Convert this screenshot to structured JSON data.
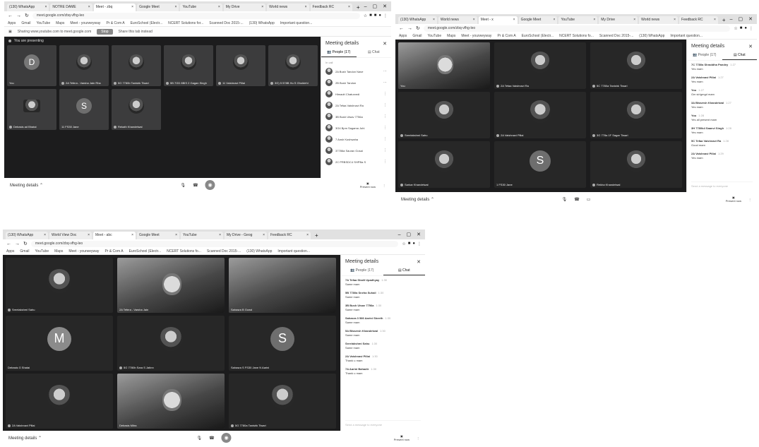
{
  "shot1": {
    "tabs": [
      "(130) WhatsApp",
      "NOTRE DAME",
      "Meet - zbq",
      "Google Meet",
      "YouTube",
      "My Drive",
      "World news",
      "Feedback RC"
    ],
    "url": "meet.google.com/zbq-vfhg-leo",
    "bookmarks": [
      "Apps",
      "Gmail",
      "YouTube",
      "Maps",
      "Meet - yourweyway",
      "Pr & Com A",
      "EuroSchool (Electr...",
      "NCERT Solutions for...",
      "Scanned Doc 2015-...",
      "(130) WhatsApp",
      "Important question..."
    ],
    "infobar_text": "Sharing www.youtube.com to meet.google.com",
    "infobar_button": "Stop",
    "infobar_hide": "Share this tab instead",
    "presenting_label": "You are presenting",
    "tiles": [
      {
        "name": "You",
        "avatar": "D"
      },
      {
        "name": "2A Tefera - Varsha Jain Rha",
        "avatar": ""
      },
      {
        "name": "5G 7780b Tanishk Tiwari",
        "avatar": ""
      },
      {
        "name": "5B 7GD 8BIS 2 Gagan Singh",
        "avatar": ""
      },
      {
        "name": "11 Vaishnavi Pillai",
        "avatar": ""
      },
      {
        "name": "3G) 5 578B Hu S Gholdehi",
        "avatar": ""
      },
      {
        "name": "Debasis ad Bhatai",
        "avatar": ""
      },
      {
        "name": "11 FS30 Jane",
        "avatar": "S"
      },
      {
        "name": "Rekath Khandelwal",
        "avatar": ""
      }
    ],
    "panel": {
      "title": "Meeting details",
      "tab_people": "People (17)",
      "tab_chat": "Chat",
      "section": "In call",
      "people": [
        "2A Bush Tandon Nave",
        "2B Bush Tandon",
        "Himadri Chaturvedi",
        "2A Tefaa Vaishnavi Ra",
        "3B Bush Utsav 7756a",
        "3G4 Bpm Sagama Juhi",
        "7 Ansh Kushwaha",
        "37786a Saurav Gosai",
        "2C PRBSDC4 SHPBa S"
      ]
    },
    "bottom": {
      "details": "Meeting details",
      "present": "Present now"
    }
  },
  "shot2": {
    "tabs": [
      "(130) WhatsApp",
      "World news",
      "Meet - x",
      "Google Meet",
      "YouTube",
      "My Drive",
      "World news",
      "Feedback RC"
    ],
    "url": "meet.google.com/zbq-vfhg-leo",
    "bookmarks": [
      "Apps",
      "Gmail",
      "YouTube",
      "Maps",
      "Meet - yourweyway",
      "Pr & Com A",
      "EuroSchool (Electr...",
      "NCERT Solutions fo...",
      "Scanned Doc 2015-...",
      "(130) WhatsApp",
      "Important question..."
    ],
    "tiles": [
      {
        "name": "You",
        "avatar": ""
      },
      {
        "name": "2A Tefaa Vaishnavi Ra",
        "avatar": ""
      },
      {
        "name": "5C 7780a Tanishk Tiwari",
        "avatar": ""
      },
      {
        "name": "Sreelakshmi Sahu",
        "avatar": ""
      },
      {
        "name": "2A Vaishnavi Pillai",
        "avatar": ""
      },
      {
        "name": "3G 778a 1F Sagar Tiwari",
        "avatar": ""
      },
      {
        "name": "Sarkar Khandelwal",
        "avatar": ""
      },
      {
        "name": "1 FS30 Jane",
        "avatar": "S"
      },
      {
        "name": "Rekha Khandelwal",
        "avatar": ""
      }
    ],
    "panel": {
      "title": "Meeting details",
      "tab_people": "People (17)",
      "tab_chat": "Chat",
      "messages": [
        {
          "who": "7C 7780a Shraddha Pandey",
          "time": "1:27",
          "text": "Yes mam"
        },
        {
          "who": "2A Vaishnavi Pillai",
          "time": "1:27",
          "text": "Yes mam"
        },
        {
          "who": "You",
          "time": "1:27",
          "text": "Gm sir/gmgd mam"
        },
        {
          "who": "3A Bhavesh Khandelwal",
          "time": "1:27",
          "text": "Yes mam"
        },
        {
          "who": "You",
          "time": "1:28",
          "text": "Yes all present mam"
        },
        {
          "who": "3H 7780b4 Saanvi Singh",
          "time": "1:28",
          "text": "Yes mam"
        },
        {
          "who": "5C Tefaa Vaishnavi Ra",
          "time": "1:28",
          "text": "Good mam"
        },
        {
          "who": "2A Vaishnavi Pillai",
          "time": "1:29",
          "text": "Yes mam"
        }
      ],
      "input": "Send a message to everyone"
    },
    "bottom": {
      "details": "Meeting details",
      "present": "Present now"
    }
  },
  "shot3": {
    "tabs": [
      "(130) WhatsApp",
      "World View Doc",
      "Meet - abc",
      "Google Meet",
      "YouTube",
      "My Drive - Geog",
      "Feedback RC"
    ],
    "url": "meet.google.com/zbq-vfhg-leo",
    "bookmarks": [
      "Apps",
      "Gmail",
      "YouTube",
      "Maps",
      "Meet - yourweyway",
      "Pr & Com A",
      "EuroSchool (Electr...",
      "NCERT Solutions fo...",
      "Scanned Doc 2015-...",
      "(130) WhatsApp",
      "Important question..."
    ],
    "tiles": [
      {
        "name": "Sreelakshmi Sahu",
        "avatar": "",
        "kind": "photo"
      },
      {
        "name": "2A Tefera - Varsha Jain",
        "avatar": "",
        "kind": "video"
      },
      {
        "name": "Sahasra B Gowd",
        "avatar": "",
        "kind": "video"
      },
      {
        "name": "Debasis G Shatai",
        "avatar": "M",
        "kind": "avatar",
        "color": "#8a8a8a"
      },
      {
        "name": "5G 7780b Sara S Jatinn",
        "avatar": "",
        "kind": "photo"
      },
      {
        "name": "Sahasra S FS30 Jane N Aarini",
        "avatar": "S",
        "kind": "avatar",
        "color": "#6f6f6f"
      },
      {
        "name": "2A Vaishnavi Pillai",
        "avatar": "",
        "kind": "photo"
      },
      {
        "name": "Debasis Mitra",
        "avatar": "",
        "kind": "video"
      },
      {
        "name": "5G 7780a Tanishk Tiwari",
        "avatar": "",
        "kind": "photo"
      }
    ],
    "panel": {
      "title": "Meeting details",
      "tab_people": "People (17)",
      "tab_chat": "Chat",
      "messages": [
        {
          "who": "7A Tefaa Shaili Upadhyay",
          "time": "1:30",
          "text": "Same mam"
        },
        {
          "who": "5B 7780a Sneha Suhail",
          "time": "1:30",
          "text": "Same mam"
        },
        {
          "who": "3B Bush Utsav 7756a",
          "time": "1:30",
          "text": "Same mam"
        },
        {
          "who": "Sahasra 3 586 Aarini Sheeth",
          "time": "1:30",
          "text": "Same mam"
        },
        {
          "who": "5A Bhavesh Khandelwal",
          "time": "1:30",
          "text": "Same mam"
        },
        {
          "who": "Sreelakshmi Sahu",
          "time": "1:30",
          "text": "Same mam"
        },
        {
          "who": "2A Vaishnavi Pillai",
          "time": "1:30",
          "text": "Thank u mam"
        },
        {
          "who": "7A Aarini Bahadir",
          "time": "1:30",
          "text": "Thank u mam"
        }
      ],
      "input": "Send a message to everyone"
    },
    "bottom": {
      "details": "Meeting details",
      "present": "Present now"
    }
  }
}
